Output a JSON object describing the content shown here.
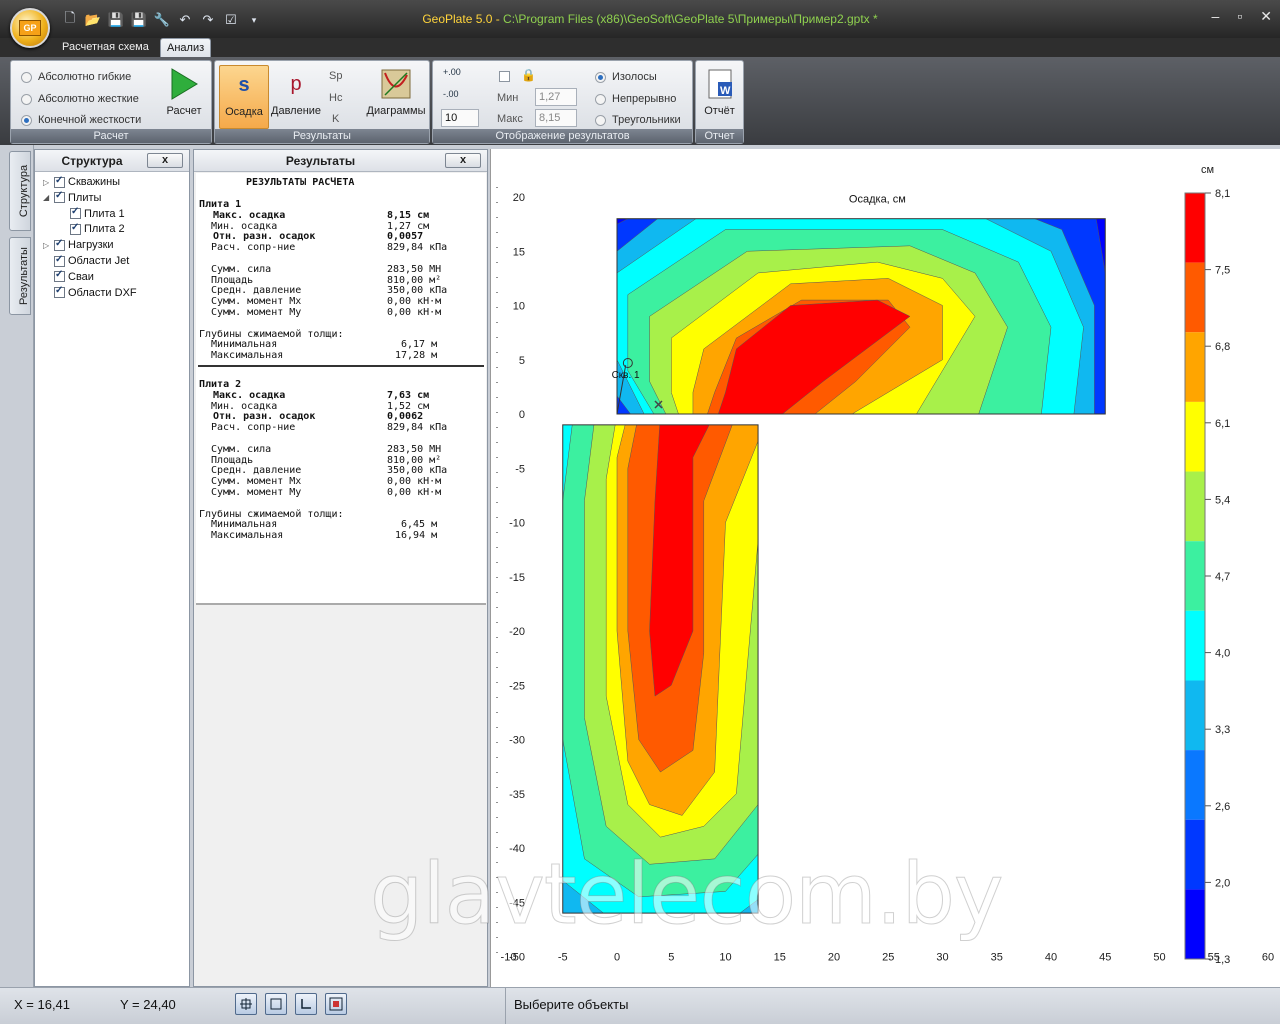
{
  "window": {
    "title_app": "GeoPlate 5.0 - ",
    "title_path": "C:\\Program Files (x86)\\GeoSoft\\GeoPlate 5\\Примеры\\Пример2.gptx *",
    "orb_label": "GP"
  },
  "quick_access": [
    "new-file-icon",
    "open-folder-icon",
    "save-icon",
    "save-as-icon",
    "settings-wrench-icon",
    "undo-icon",
    "redo-icon",
    "check-tool-icon",
    "qat-dropdown-icon"
  ],
  "tabs": {
    "schema": "Расчетная схема",
    "analysis": "Анализ"
  },
  "ribbon": {
    "calc_group": {
      "label": "Расчет",
      "options": [
        "Абсолютно гибкие",
        "Абсолютно жесткие",
        "Конечной жесткости"
      ],
      "selected_index": 2,
      "run_button": "Расчет"
    },
    "results_group": {
      "label": "Результаты",
      "settlement_button": "Осадка",
      "settlement_glyph": "s",
      "pressure_button": "Давление",
      "pressure_glyph": "p",
      "small_items": [
        "Sp",
        "Hc",
        "K"
      ],
      "diagrams_button": "Диаграммы"
    },
    "display_group": {
      "label": "Отображение результатов",
      "min_label": "Мин",
      "max_label": "Макс",
      "min_value": "1,27",
      "max_value": "8,15",
      "levels_value": "10",
      "modes": [
        "Изолосы",
        "Непрерывно",
        "Треугольники"
      ],
      "selected_mode_index": 0
    },
    "report_group": {
      "label": "Отчет",
      "report_button": "Отчёт"
    }
  },
  "side_tabs": {
    "structure": "Структура",
    "results": "Результаты"
  },
  "structure_panel": {
    "title": "Структура",
    "close": "x",
    "items": [
      {
        "label": "Скважины",
        "level": 0,
        "arrow": "▷"
      },
      {
        "label": "Плиты",
        "level": 0,
        "arrow": "◢"
      },
      {
        "label": "Плита 1",
        "level": 1,
        "arrow": ""
      },
      {
        "label": "Плита 2",
        "level": 1,
        "arrow": ""
      },
      {
        "label": "Нагрузки",
        "level": 0,
        "arrow": "▷"
      },
      {
        "label": "Области Jet",
        "level": 0,
        "arrow": ""
      },
      {
        "label": "Сваи",
        "level": 0,
        "arrow": ""
      },
      {
        "label": "Области DXF",
        "level": 0,
        "arrow": ""
      }
    ]
  },
  "results_panel": {
    "title": "Результаты",
    "close": "x",
    "heading": "РЕЗУЛЬТАТЫ РАСЧЕТА",
    "plates": [
      {
        "name": "Плита 1",
        "rows": [
          {
            "label": "Макс. осадка",
            "value": "8,15 см",
            "bold": true
          },
          {
            "label": "Мин. осадка",
            "value": "1,27 см",
            "bold": false
          },
          {
            "label": "Отн. разн. осадок",
            "value": "0,0057",
            "bold": true
          },
          {
            "label": "Расч. сопр-ние",
            "value": "829,84 кПа",
            "bold": false
          },
          {
            "label": "Сумм. сила",
            "value": "283,50 МН",
            "bold": false
          },
          {
            "label": "Площадь",
            "value": "810,00 м²",
            "bold": false
          },
          {
            "label": "Средн. давление",
            "value": "350,00 кПа",
            "bold": false
          },
          {
            "label": "Сумм. момент Mx",
            "value": "0,00 кН·м",
            "bold": false
          },
          {
            "label": "Сумм. момент My",
            "value": "0,00 кН·м",
            "bold": false
          }
        ],
        "depth_heading": "Глубины сжимаемой толщи:",
        "depth_min_label": "Минимальная",
        "depth_min": "6,17 м",
        "depth_max_label": "Максимальная",
        "depth_max": "17,28 м"
      },
      {
        "name": "Плита 2",
        "rows": [
          {
            "label": "Макс. осадка",
            "value": "7,63 см",
            "bold": true
          },
          {
            "label": "Мин. осадка",
            "value": "1,52 см",
            "bold": false
          },
          {
            "label": "Отн. разн. осадок",
            "value": "0,0062",
            "bold": true
          },
          {
            "label": "Расч. сопр-ние",
            "value": "829,84 кПа",
            "bold": false
          },
          {
            "label": "Сумм. сила",
            "value": "283,50 МН",
            "bold": false
          },
          {
            "label": "Площадь",
            "value": "810,00 м²",
            "bold": false
          },
          {
            "label": "Средн. давление",
            "value": "350,00 кПа",
            "bold": false
          },
          {
            "label": "Сумм. момент Mx",
            "value": "0,00 кН·м",
            "bold": false
          },
          {
            "label": "Сумм. момент My",
            "value": "0,00 кН·м",
            "bold": false
          }
        ],
        "depth_heading": "Глубины сжимаемой толщи:",
        "depth_min_label": "Минимальная",
        "depth_min": "6,45 м",
        "depth_max_label": "Максимальная",
        "depth_max": "16,94 м"
      }
    ]
  },
  "plot": {
    "title": "Осадка, см",
    "unit": "см",
    "borehole_label": "Скв. 1",
    "x_ticks": [
      "-10",
      "-5",
      "0",
      "5",
      "10",
      "15",
      "20",
      "25",
      "30",
      "35",
      "40",
      "45",
      "50",
      "55",
      "60"
    ],
    "y_ticks": [
      "20",
      "15",
      "10",
      "5",
      "0",
      "-5",
      "-10",
      "-15",
      "-20",
      "-25",
      "-30",
      "-35",
      "-40",
      "-45",
      "-50"
    ],
    "legend_values": [
      "8,1",
      "7,5",
      "6,8",
      "6,1",
      "5,4",
      "4,7",
      "4,0",
      "3,3",
      "2,6",
      "2,0",
      "1,3"
    ],
    "legend_colors": [
      "#ff0000",
      "#ff5a00",
      "#ffa500",
      "#ffff00",
      "#a8f04a",
      "#3cf0a0",
      "#00ffff",
      "#10b8f0",
      "#0a78ff",
      "#0038ff",
      "#0000ff"
    ],
    "x_range": [
      -10,
      60
    ],
    "y_range": [
      -50,
      20
    ]
  },
  "status": {
    "x": "X = 16,41",
    "y": "Y = 24,40",
    "message": "Выберите объекты",
    "buttons": [
      "snap-grid-icon",
      "snap-rect-icon",
      "ortho-icon",
      "zoom-extents-icon"
    ]
  },
  "watermark": "glavtelecom.by"
}
